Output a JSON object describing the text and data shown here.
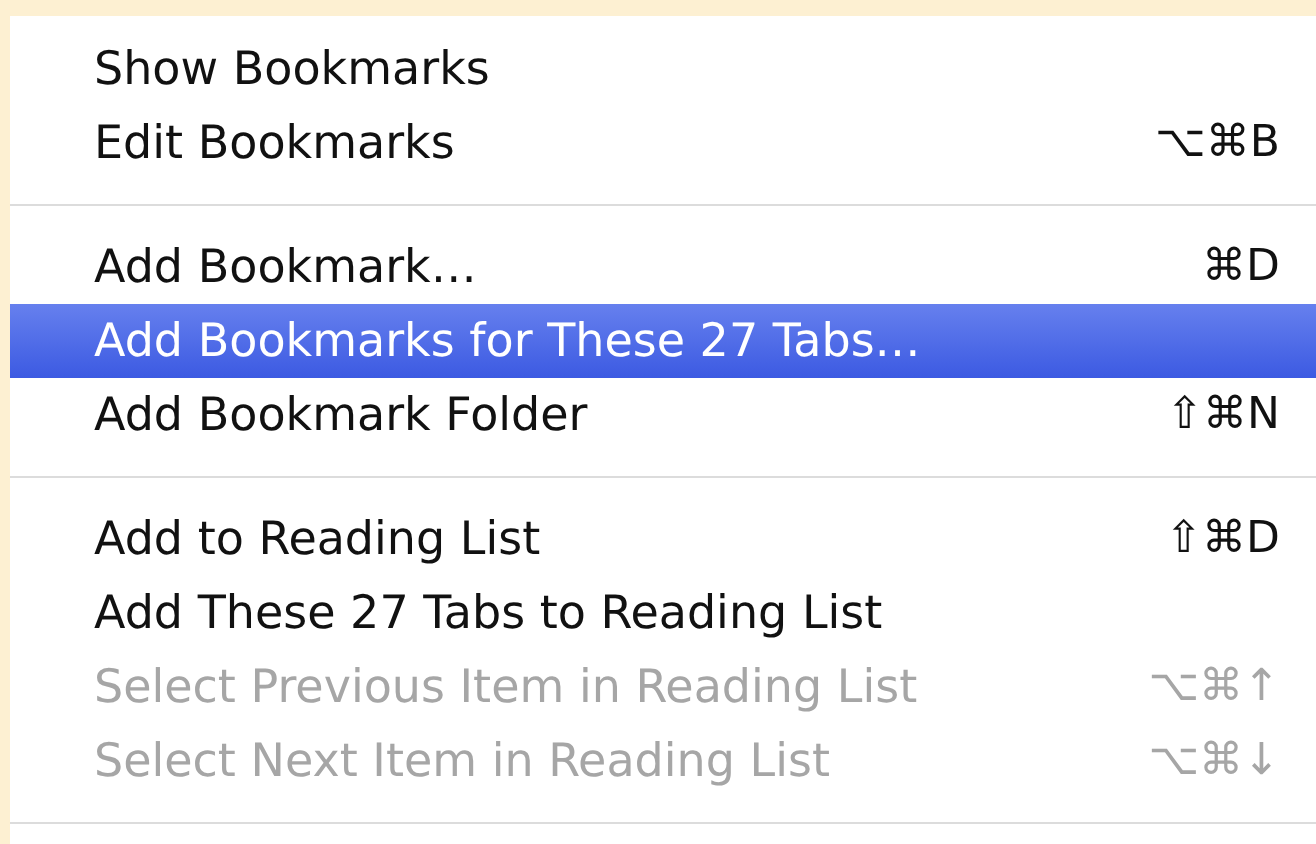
{
  "menu": {
    "sections": [
      {
        "items": [
          {
            "label": "Show Bookmarks",
            "selected": false,
            "disabled": false
          },
          {
            "label": "Edit Bookmarks",
            "shortcut": "⌥⌘B",
            "selected": false,
            "disabled": false
          }
        ]
      },
      {
        "items": [
          {
            "label": "Add Bookmark…",
            "shortcut": "⌘D",
            "selected": false,
            "disabled": false
          },
          {
            "label": "Add Bookmarks for These 27 Tabs…",
            "selected": true,
            "disabled": false
          },
          {
            "label": "Add Bookmark Folder",
            "shortcut": "⇧⌘N",
            "selected": false,
            "disabled": false
          }
        ]
      },
      {
        "items": [
          {
            "label": "Add to Reading List",
            "shortcut": "⇧⌘D",
            "selected": false,
            "disabled": false
          },
          {
            "label": "Add These 27 Tabs to Reading List",
            "selected": false,
            "disabled": false
          },
          {
            "label": "Select Previous Item in Reading List",
            "shortcut": "⌥⌘↑",
            "selected": false,
            "disabled": true
          },
          {
            "label": "Select Next Item in Reading List",
            "shortcut": "⌥⌘↓",
            "selected": false,
            "disabled": true
          }
        ]
      }
    ]
  }
}
